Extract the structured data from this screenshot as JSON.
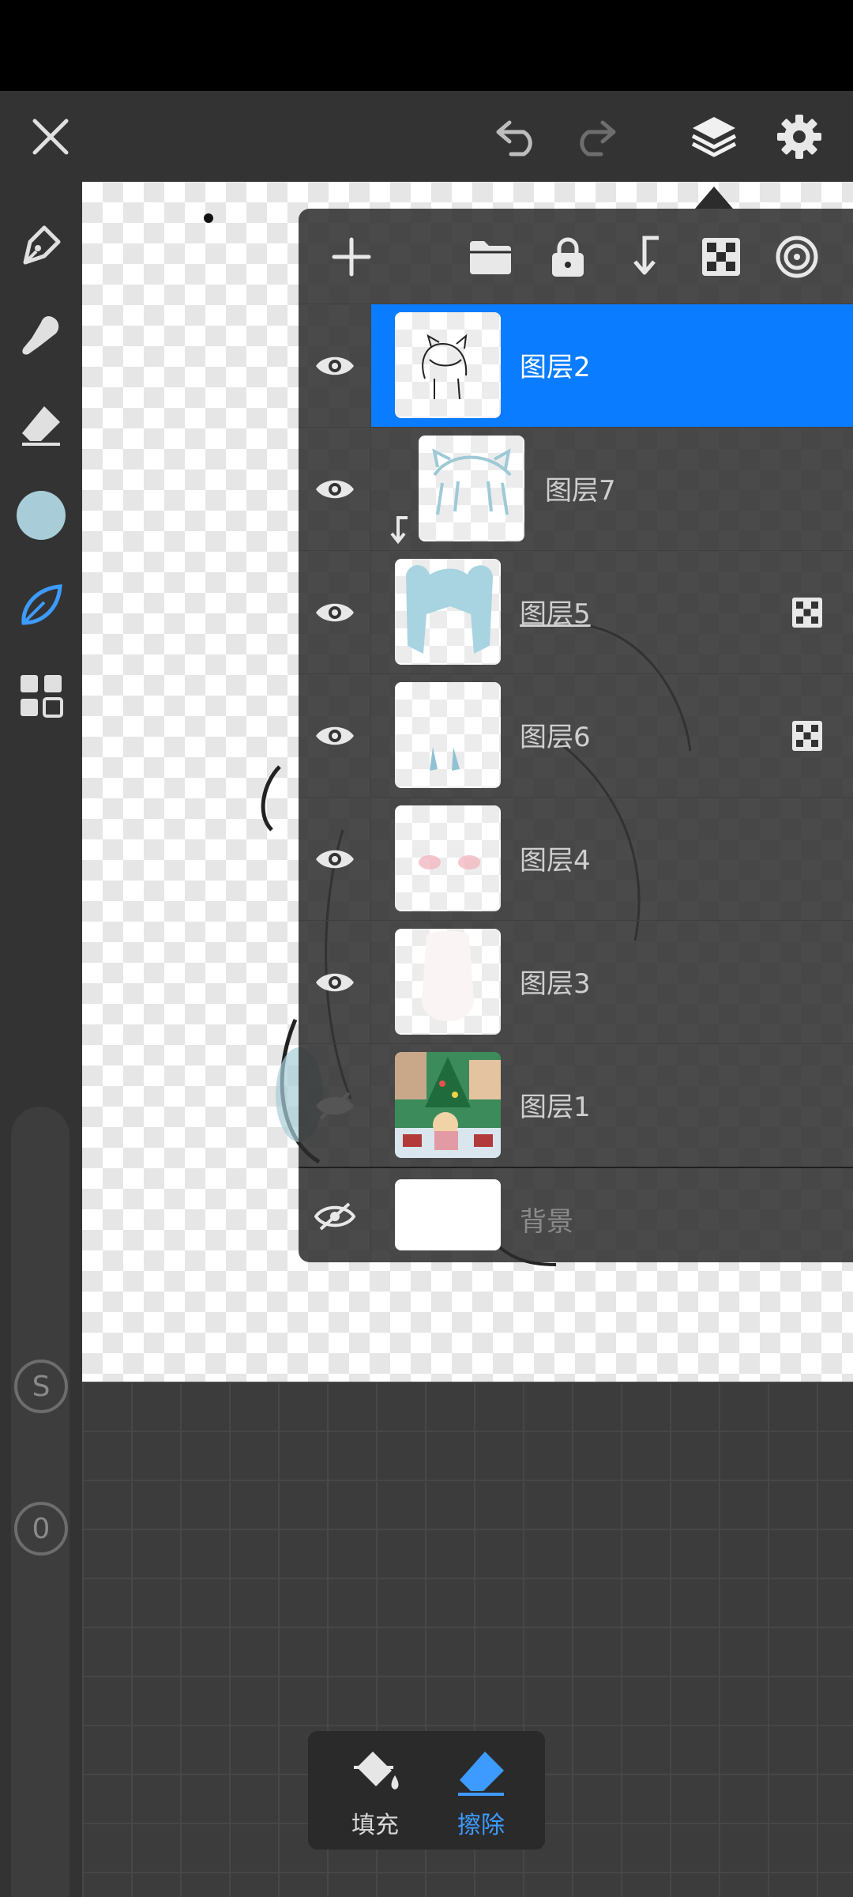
{
  "colors": {
    "accent": "#0a7cff",
    "current_color": "#a8cdd8",
    "tool_active": "#3d9bff"
  },
  "topbar": {
    "close_icon": "close-icon",
    "undo_icon": "undo-icon",
    "redo_icon": "redo-icon",
    "layers_icon": "layers-icon",
    "settings_icon": "gear-icon"
  },
  "left_tools": [
    "pen-icon",
    "smudge-icon",
    "eraser-icon",
    "color-swatch",
    "leaf-brush-icon",
    "grid-menu-icon"
  ],
  "sliders": {
    "size_label": "S",
    "opacity_label": "0"
  },
  "layers_panel": {
    "header_icons": [
      "add-layer-icon",
      "folder-icon",
      "lock-icon",
      "clip-down-icon",
      "alpha-lock-icon",
      "mask-target-icon"
    ],
    "layers": [
      {
        "name": "图层2",
        "visible": true,
        "selected": true,
        "clipped": false,
        "alpha_lock": false
      },
      {
        "name": "图层7",
        "visible": true,
        "selected": false,
        "clipped": true,
        "alpha_lock": false
      },
      {
        "name": "图层5",
        "visible": true,
        "selected": false,
        "clipped": false,
        "alpha_lock": true
      },
      {
        "name": "图层6",
        "visible": true,
        "selected": false,
        "clipped": false,
        "alpha_lock": true
      },
      {
        "name": "图层4",
        "visible": true,
        "selected": false,
        "clipped": false,
        "alpha_lock": false
      },
      {
        "name": "图层3",
        "visible": true,
        "selected": false,
        "clipped": false,
        "alpha_lock": false
      },
      {
        "name": "图层1",
        "visible": false,
        "selected": false,
        "clipped": false,
        "alpha_lock": false
      },
      {
        "name": "背景",
        "visible": false,
        "selected": false,
        "clipped": false,
        "alpha_lock": false
      }
    ]
  },
  "bottom_popup": {
    "fill_label": "填充",
    "erase_label": "擦除"
  }
}
